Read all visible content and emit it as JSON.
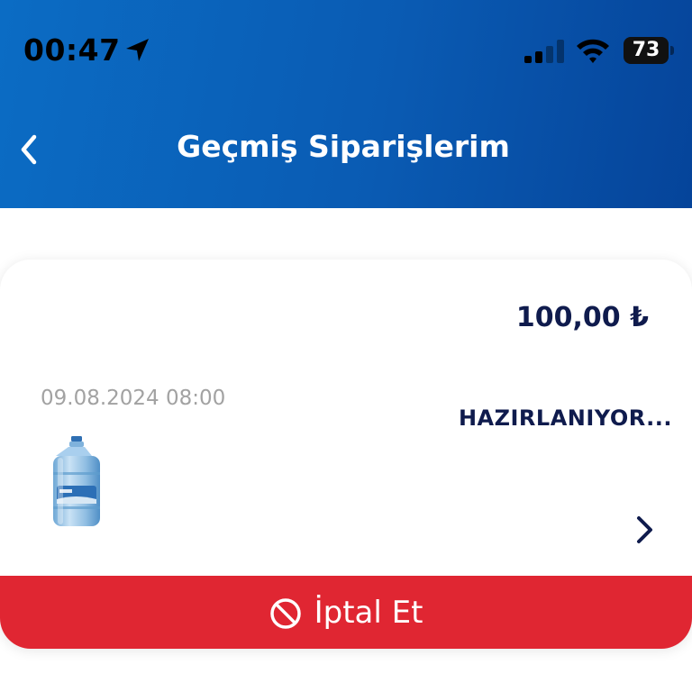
{
  "status_bar": {
    "time": "00:47",
    "battery": "73"
  },
  "header": {
    "title": "Geçmiş Siparişlerim"
  },
  "order": {
    "price": "100,00 ₺",
    "date": "09.08.2024 08:00",
    "status": "HAZIRLANIYOR...",
    "cancel_label": "İptal Et"
  },
  "colors": {
    "header_blue": "#0a5bb3",
    "cancel_red": "#e02632",
    "text_navy": "#0f1b4d"
  }
}
